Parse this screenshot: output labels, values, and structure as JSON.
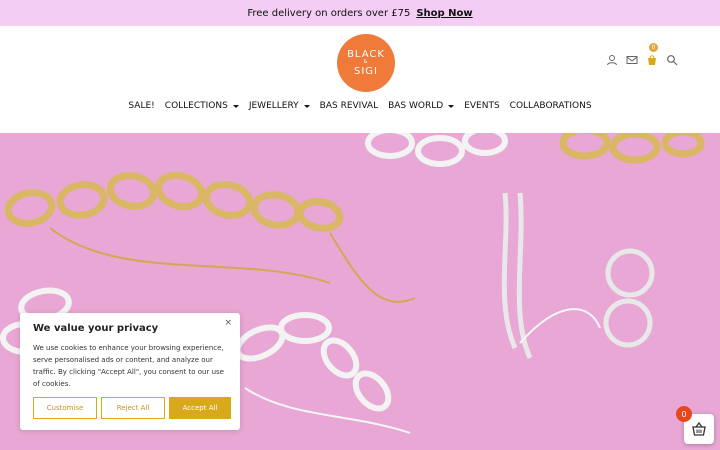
{
  "promo": {
    "text": "Free delivery on orders over £75",
    "link": "Shop Now"
  },
  "logo": {
    "line1": "BLACK",
    "amp": "&",
    "line2": "SIGI"
  },
  "header": {
    "cart_count": "0",
    "icons": [
      "user-icon",
      "mail-icon",
      "cart-icon",
      "search-icon"
    ]
  },
  "nav": {
    "items": [
      {
        "label": "SALE!"
      },
      {
        "label": "COLLECTIONS"
      },
      {
        "label": "JEWELLERY"
      },
      {
        "label": "BAS REVIVAL"
      },
      {
        "label": "BAS WORLD"
      },
      {
        "label": "EVENTS"
      },
      {
        "label": "COLLABORATIONS"
      }
    ]
  },
  "cookie": {
    "title": "We value your privacy",
    "text": "We use cookies to enhance your browsing experience, serve personalised ads or content, and analyze our traffic. By clicking \"Accept All\", you consent to our use of cookies.",
    "close": "×",
    "customise": "Customise",
    "reject": "Reject All",
    "accept": "Accept All"
  },
  "floating_cart": {
    "count": "0"
  },
  "colors": {
    "promo_bg": "#f3cdf3",
    "logo": "#f07a3a",
    "cookie_accent": "#d9a91c",
    "hero_bg": "#e8a7d4"
  }
}
